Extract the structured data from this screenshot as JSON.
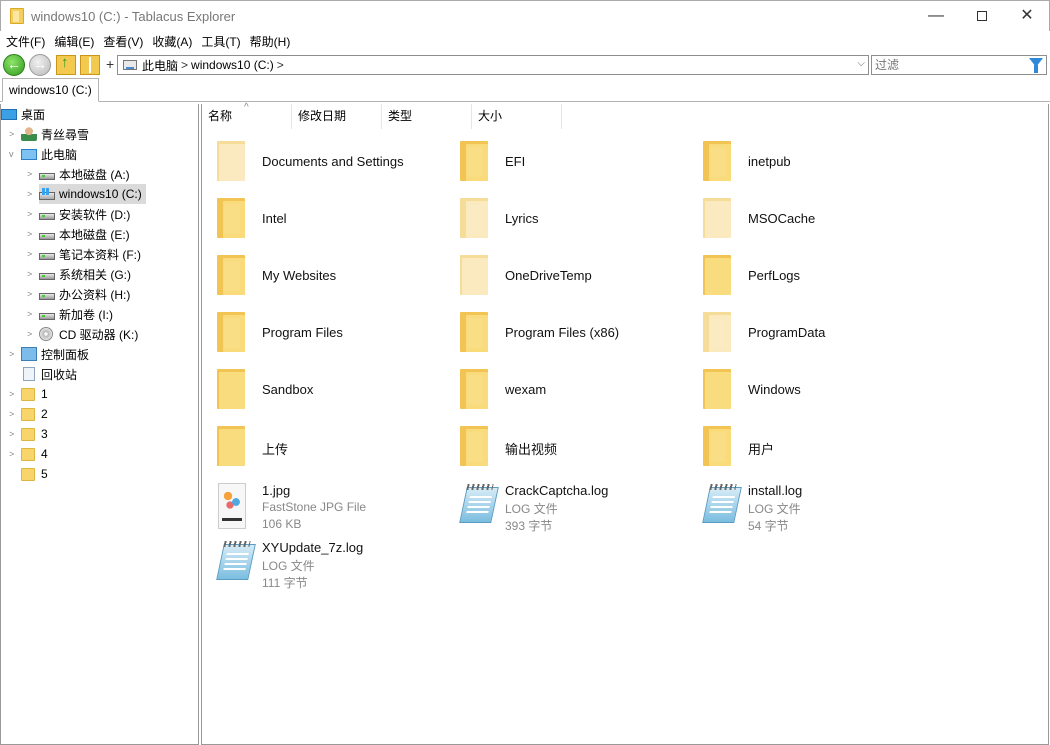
{
  "window": {
    "title": "windows10 (C:) - Tablacus Explorer",
    "minimize_glyph": "—",
    "close_glyph": "✕"
  },
  "menu": [
    "文件(F)",
    "编辑(E)",
    "查看(V)",
    "收藏(A)",
    "工具(T)",
    "帮助(H)"
  ],
  "toolbar": {
    "back_glyph": "←",
    "forward_glyph": "→",
    "up_glyph": "↑",
    "plus_glyph": "+",
    "address_parts": [
      "此电脑",
      "windows10 (C:)"
    ],
    "address_sep": ">",
    "address_trailing": ">",
    "dropdown_glyph": "⌵",
    "filter_placeholder": "过滤"
  },
  "tab": {
    "label": "windows10 (C:)"
  },
  "tree": [
    {
      "label": "桌面",
      "icon": "desktop-icon",
      "level": 0,
      "expander": ""
    },
    {
      "label": "青丝尋雪",
      "icon": "user-icon",
      "level": 1,
      "expander": ">"
    },
    {
      "label": "此电脑",
      "icon": "pc-icon",
      "level": 1,
      "expander": "v"
    },
    {
      "label": "本地磁盘 (A:)",
      "icon": "drive-icon",
      "level": 2,
      "expander": ">"
    },
    {
      "label": "windows10 (C:)",
      "icon": "windows-drive-icon",
      "level": 2,
      "expander": ">",
      "selected": true
    },
    {
      "label": "安装软件 (D:)",
      "icon": "drive-icon",
      "level": 2,
      "expander": ">"
    },
    {
      "label": "本地磁盘 (E:)",
      "icon": "drive-icon",
      "level": 2,
      "expander": ">"
    },
    {
      "label": "笔记本资料 (F:)",
      "icon": "drive-icon",
      "level": 2,
      "expander": ">"
    },
    {
      "label": "系统相关 (G:)",
      "icon": "drive-icon",
      "level": 2,
      "expander": ">"
    },
    {
      "label": "办公资料 (H:)",
      "icon": "drive-icon",
      "level": 2,
      "expander": ">"
    },
    {
      "label": "新加卷 (I:)",
      "icon": "drive-icon",
      "level": 2,
      "expander": ">"
    },
    {
      "label": "CD 驱动器 (K:)",
      "icon": "cd-drive-icon",
      "level": 2,
      "expander": ">"
    },
    {
      "label": "控制面板",
      "icon": "control-panel-icon",
      "level": 1,
      "expander": ">"
    },
    {
      "label": "回收站",
      "icon": "recycle-bin-icon",
      "level": 1,
      "expander": ""
    },
    {
      "label": "1",
      "icon": "folder-icon",
      "level": 1,
      "expander": ">"
    },
    {
      "label": "2",
      "icon": "folder-icon",
      "level": 1,
      "expander": ">"
    },
    {
      "label": "3",
      "icon": "folder-icon",
      "level": 1,
      "expander": ">"
    },
    {
      "label": "4",
      "icon": "folder-icon",
      "level": 1,
      "expander": ">"
    },
    {
      "label": "5",
      "icon": "folder-icon",
      "level": 1,
      "expander": ""
    }
  ],
  "columns": [
    "名称",
    "修改日期",
    "类型",
    "大小"
  ],
  "sort_glyph": "^",
  "files": [
    {
      "name": "Documents and Settings",
      "kind": "folder-faded"
    },
    {
      "name": "EFI",
      "kind": "folder-paper"
    },
    {
      "name": "inetpub",
      "kind": "folder-paper"
    },
    {
      "name": "Intel",
      "kind": "folder-paper"
    },
    {
      "name": "Lyrics",
      "kind": "folder-paper-faded"
    },
    {
      "name": "MSOCache",
      "kind": "folder-faded"
    },
    {
      "name": "My Websites",
      "kind": "folder-paper"
    },
    {
      "name": "OneDriveTemp",
      "kind": "folder-faded"
    },
    {
      "name": "PerfLogs",
      "kind": "folder"
    },
    {
      "name": "Program Files",
      "kind": "folder-paper"
    },
    {
      "name": "Program Files (x86)",
      "kind": "folder-paper"
    },
    {
      "name": "ProgramData",
      "kind": "folder-paper-faded"
    },
    {
      "name": "Sandbox",
      "kind": "folder"
    },
    {
      "name": "wexam",
      "kind": "folder-paper"
    },
    {
      "name": "Windows",
      "kind": "folder"
    },
    {
      "name": "上传",
      "kind": "folder"
    },
    {
      "name": "输出视频",
      "kind": "folder-paper"
    },
    {
      "name": "用户",
      "kind": "folder-paper"
    },
    {
      "name": "1.jpg",
      "kind": "image",
      "type": "FastStone JPG File",
      "size": "106 KB"
    },
    {
      "name": "CrackCaptcha.log",
      "kind": "log",
      "type": "LOG 文件",
      "size": "393 字节"
    },
    {
      "name": "install.log",
      "kind": "log",
      "type": "LOG 文件",
      "size": "54 字节"
    },
    {
      "name": "XYUpdate_7z.log",
      "kind": "log",
      "type": "LOG 文件",
      "size": "111 字节"
    }
  ]
}
